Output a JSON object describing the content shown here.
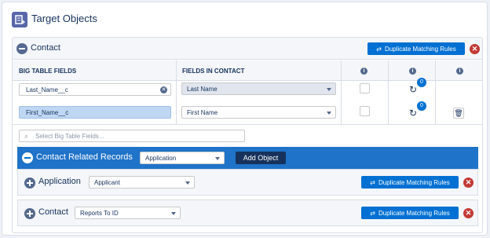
{
  "header": {
    "title": "Target Objects"
  },
  "contact": {
    "title": "Contact",
    "dup_label": "Duplicate Matching Rules",
    "columns": {
      "big": "BIG TABLE FIELDS",
      "fields": "FIELDS IN CONTACT"
    },
    "info_glyph": "i",
    "rows": [
      {
        "big_field": "Last_Name__c",
        "contact_field": "Last Name",
        "count": "0"
      },
      {
        "big_field": "First_Name__c",
        "contact_field": "First Name",
        "count": "0"
      }
    ],
    "search_placeholder": "Select Big Table Fields..."
  },
  "related": {
    "title": "Contact Related Records",
    "select_value": "Application",
    "add_label": "Add Object"
  },
  "sub_objects": [
    {
      "title": "Application",
      "select_value": "Applicant",
      "dup_label": "Duplicate Matching Rules"
    },
    {
      "title": "Contact",
      "select_value": "Reports To ID",
      "dup_label": "Duplicate Matching Rules"
    }
  ],
  "colors": {
    "accent": "#0070d2",
    "related_bar": "#1f73c8",
    "danger": "#c23934",
    "dark_button": "#16325c"
  }
}
